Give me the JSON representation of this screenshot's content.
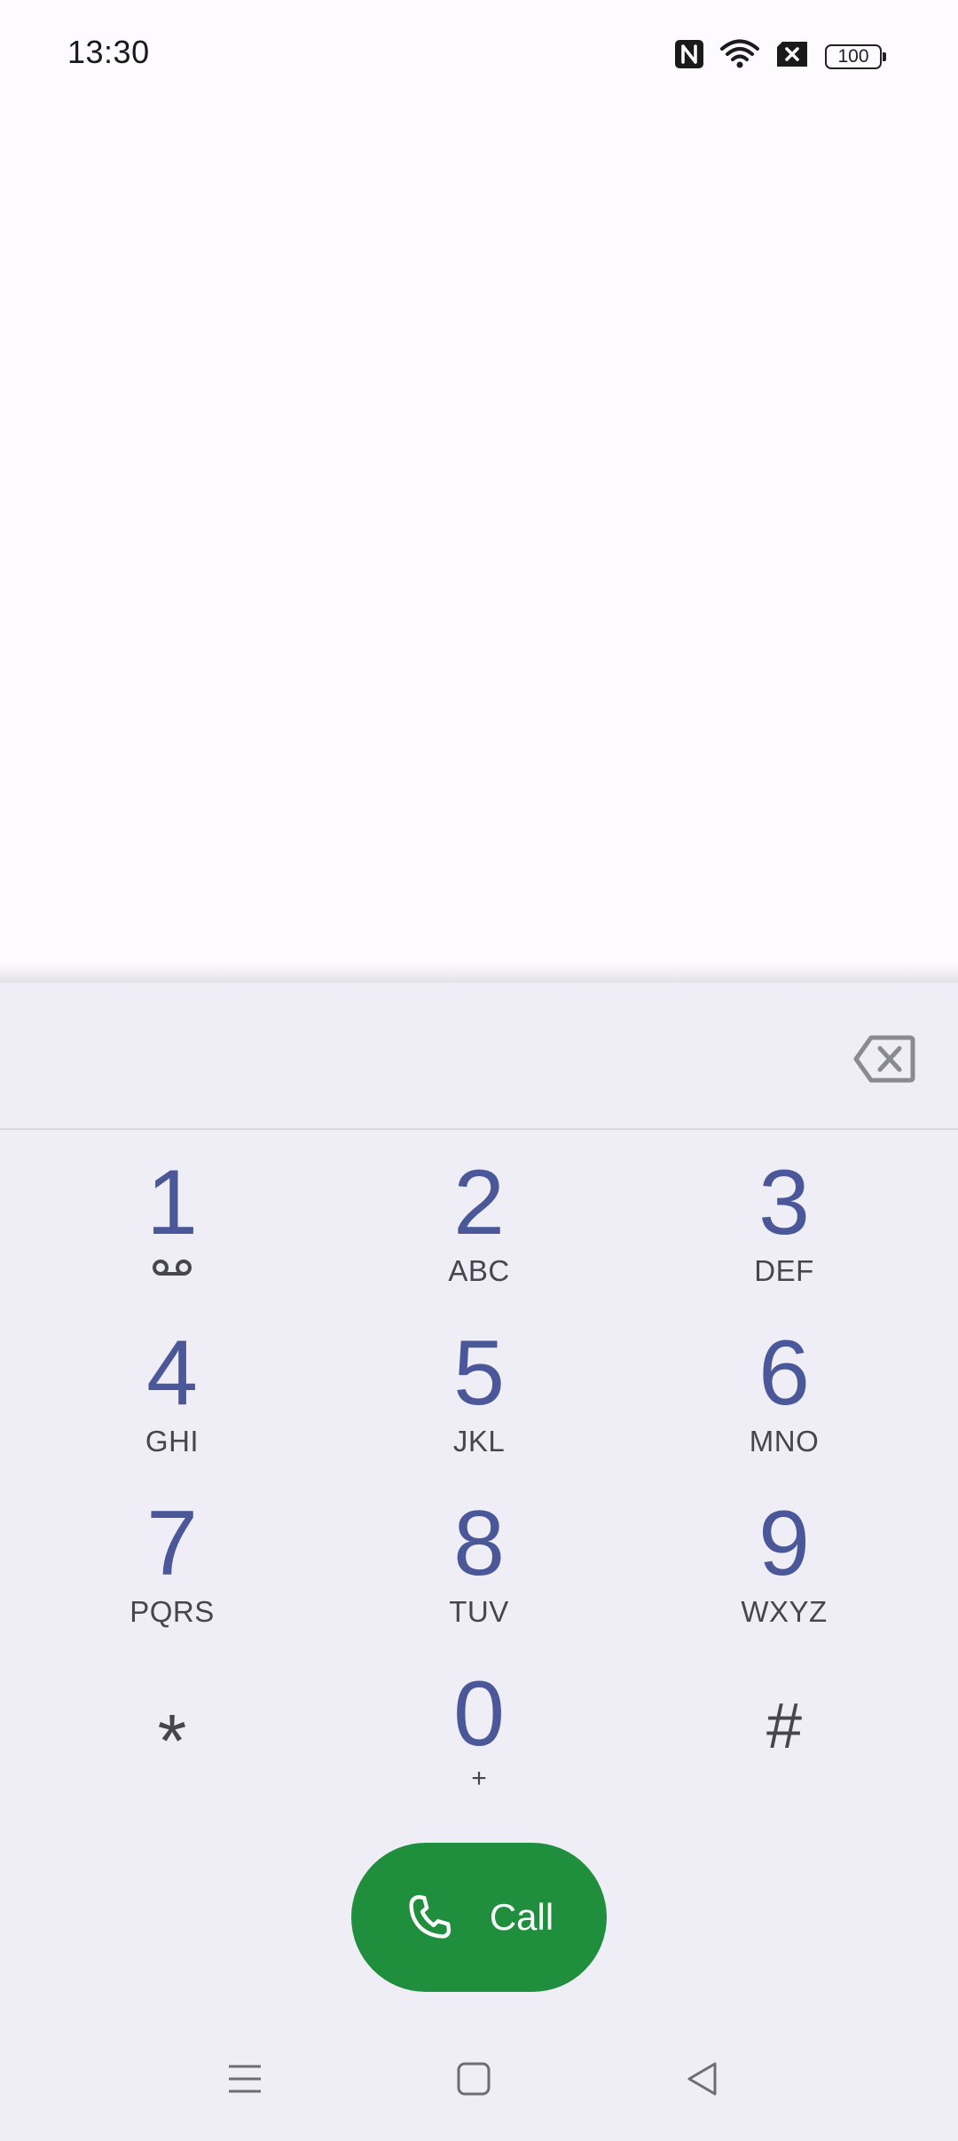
{
  "status_bar": {
    "time": "13:30",
    "battery": "100",
    "icons": [
      "nfc-icon",
      "wifi-icon",
      "no-sim-icon",
      "battery-icon"
    ]
  },
  "dialer": {
    "number": "",
    "keys": [
      {
        "digit": "1",
        "letters": "",
        "sub_icon": "voicemail-icon"
      },
      {
        "digit": "2",
        "letters": "ABC"
      },
      {
        "digit": "3",
        "letters": "DEF"
      },
      {
        "digit": "4",
        "letters": "GHI"
      },
      {
        "digit": "5",
        "letters": "JKL"
      },
      {
        "digit": "6",
        "letters": "MNO"
      },
      {
        "digit": "7",
        "letters": "PQRS"
      },
      {
        "digit": "8",
        "letters": "TUV"
      },
      {
        "digit": "9",
        "letters": "WXYZ"
      },
      {
        "digit": "*",
        "letters": ""
      },
      {
        "digit": "0",
        "letters": "+"
      },
      {
        "digit": "#",
        "letters": ""
      }
    ],
    "call_label": "Call"
  },
  "colors": {
    "accent_digit": "#4a5799",
    "call_green": "#1f8f3e",
    "panel_bg": "#efedf5"
  }
}
